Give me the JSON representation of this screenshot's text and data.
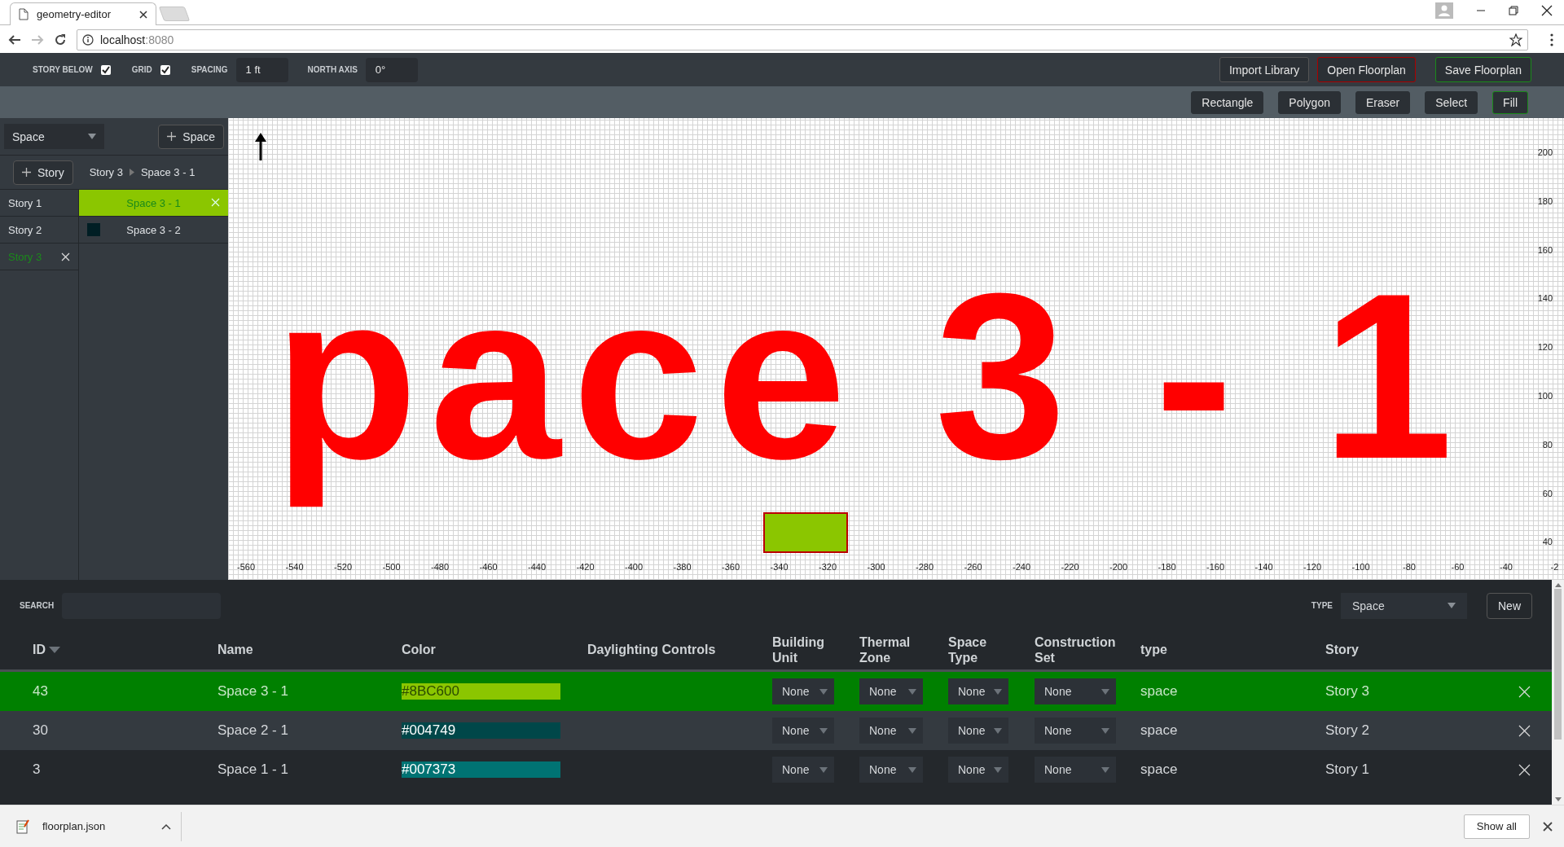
{
  "browser": {
    "tab": {
      "title": "geometry-editor"
    },
    "forward_button": {
      "disabled": true
    },
    "address": {
      "host": "localhost",
      "port": ":8080"
    }
  },
  "toolbar": {
    "toggles": [
      {
        "label": "STORY BELOW",
        "checked": true
      },
      {
        "label": "GRID",
        "checked": true
      }
    ],
    "fields": [
      {
        "label": "SPACING",
        "value": "1 ft"
      },
      {
        "label": "NORTH AXIS",
        "value": "0°"
      }
    ],
    "buttons": [
      {
        "label": "Import Library",
        "kind": "neutral"
      },
      {
        "label": "Open Floorplan",
        "kind": "danger"
      },
      {
        "label": "Save Floorplan",
        "kind": "success"
      }
    ]
  },
  "tools": [
    {
      "label": "Rectangle",
      "selected": false
    },
    {
      "label": "Polygon",
      "selected": false
    },
    {
      "label": "Eraser",
      "selected": false
    },
    {
      "label": "Select",
      "selected": false
    },
    {
      "label": "Fill",
      "selected": true
    }
  ],
  "sidebar": {
    "mode_select": {
      "value": "Space"
    },
    "add_space_button": {
      "label": "Space"
    },
    "add_story_button": {
      "label": "Story"
    },
    "breadcrumb": [
      "Story 3",
      "Space 3 - 1"
    ],
    "stories": [
      {
        "name": "Story 1",
        "selected": false
      },
      {
        "name": "Story 2",
        "selected": false
      },
      {
        "name": "Story 3",
        "selected": true
      }
    ],
    "spaces": [
      {
        "name": "Space 3 - 1",
        "color": "#8bc600",
        "selected": true
      },
      {
        "name": "Space 3 - 2",
        "color": "#001e24",
        "selected": false
      }
    ]
  },
  "canvas": {
    "label": "pace 3 - 1",
    "y_ticks": [
      "200",
      "180",
      "160",
      "140",
      "120",
      "100",
      "80",
      "60",
      "40"
    ],
    "x_ticks": [
      "-560",
      "-540",
      "-520",
      "-500",
      "-480",
      "-460",
      "-440",
      "-420",
      "-400",
      "-380",
      "-360",
      "-340",
      "-320",
      "-300",
      "-280",
      "-260",
      "-240",
      "-220",
      "-200",
      "-180",
      "-160",
      "-140",
      "-120",
      "-100",
      "-80",
      "-60",
      "-40",
      "-2"
    ]
  },
  "table": {
    "search": {
      "label": "SEARCH"
    },
    "type_filter": {
      "label": "TYPE",
      "value": "Space"
    },
    "new_button": {
      "label": "New"
    },
    "columns": [
      {
        "label": "ID",
        "sorted": true
      },
      {
        "label": "Name",
        "sorted": false
      },
      {
        "label": "Color",
        "sorted": false
      },
      {
        "label": "Daylighting Controls",
        "sorted": false
      },
      {
        "label": "Building Unit",
        "sorted": false
      },
      {
        "label": "Thermal Zone",
        "sorted": false
      },
      {
        "label": "Space Type",
        "sorted": false
      },
      {
        "label": "Construction Set",
        "sorted": false
      },
      {
        "label": "type",
        "sorted": false
      },
      {
        "label": "Story",
        "sorted": false
      }
    ],
    "rows": [
      {
        "id": "43",
        "name": "Space 3 - 1",
        "color": "#8BC600",
        "building_unit": "None",
        "thermal_zone": "None",
        "space_type": "None",
        "construction_set": "None",
        "type": "space",
        "story": "Story 3",
        "selected": true
      },
      {
        "id": "30",
        "name": "Space 2 - 1",
        "color": "#004749",
        "building_unit": "None",
        "thermal_zone": "None",
        "space_type": "None",
        "construction_set": "None",
        "type": "space",
        "story": "Story 2",
        "selected": false
      },
      {
        "id": "3",
        "name": "Space 1 - 1",
        "color": "#007373",
        "building_unit": "None",
        "thermal_zone": "None",
        "space_type": "None",
        "construction_set": "None",
        "type": "space",
        "story": "Story 1",
        "selected": false
      }
    ]
  },
  "downloads": {
    "file": "floorplan.json",
    "show_all": "Show all"
  }
}
